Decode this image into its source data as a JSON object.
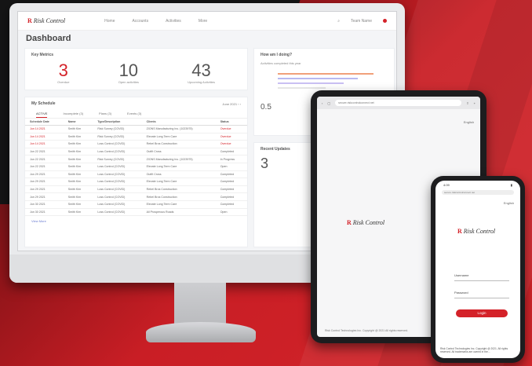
{
  "brand": {
    "name": "Risk Control",
    "mark": "R"
  },
  "nav": {
    "items": [
      "Home",
      "Accounts",
      "Activities",
      "More"
    ],
    "user": "Team Name"
  },
  "dashboard": {
    "title": "Dashboard",
    "metrics_title": "Key Metrics",
    "metrics": [
      {
        "value": "3",
        "label": "Overdue"
      },
      {
        "value": "10",
        "label": "Open activities"
      },
      {
        "value": "43",
        "label": "Upcoming Activities"
      }
    ],
    "schedule": {
      "title": "My Schedule",
      "period": "June 2021",
      "tabs": [
        "ACTIVE",
        "Incomplete (3)",
        "Plans (3)",
        "Events (3)"
      ],
      "columns": [
        "Schedule Date",
        "Name",
        "Type/Description",
        "Clients",
        "Status"
      ],
      "rows": [
        [
          "Jun 14 2021",
          "Smith Kim",
          "Risk Survey (COVID)",
          "ZIONS Manufacturing Inc. (1023975)",
          "Overdue"
        ],
        [
          "Jun 14 2021",
          "Smith Kim",
          "Risk Survey (COVID)",
          "Elevate Long Term Care",
          "Overdue"
        ],
        [
          "Jun 14 2021",
          "Smith Kim",
          "Loss Control (COVID)",
          "Rebel Bros Construction",
          "Overdue"
        ],
        [
          "Jun 22 2021",
          "Smith Kim",
          "Loss Control (COVID)",
          "Outfit Cross",
          "Completed"
        ],
        [
          "Jun 22 2021",
          "Smith Kim",
          "Risk Survey (COVID)",
          "ZIONS Manufacturing Inc. (1023975)",
          "In Progress"
        ],
        [
          "Jun 22 2021",
          "Smith Kim",
          "Loss Control (COVID)",
          "Elevate Long Term Care",
          "Open"
        ],
        [
          "Jun 29 2021",
          "Smith Kim",
          "Loss Control (COVID)",
          "Outfit Cross",
          "Completed"
        ],
        [
          "Jun 29 2021",
          "Smith Kim",
          "Loss Control (COVID)",
          "Elevate Long Term Care",
          "Completed"
        ],
        [
          "Jun 29 2021",
          "Smith Kim",
          "Loss Control (COVID)",
          "Rebel Bros Construction",
          "Completed"
        ],
        [
          "Jun 29 2021",
          "Smith Kim",
          "Loss Control (COVID)",
          "Rebel Bros Construction",
          "Completed"
        ],
        [
          "Jun 30 2021",
          "Smith Kim",
          "Loss Control (COVID)",
          "Elevate Long Term Care",
          "Completed"
        ],
        [
          "Jun 30 2021",
          "Smith Kim",
          "Loss Control (COVID)",
          "All Prosperous Roads",
          "Open"
        ]
      ],
      "view_more": "View More"
    },
    "how_title": "How am I doing?",
    "how_subtitle": "Activities completed this year",
    "recent_title": "Recent Updates",
    "recent_count": "3",
    "stat": "0.5"
  },
  "tablet": {
    "url": "secure.riskcontrolconnect.net",
    "lang": "English",
    "footer": "Risk Control Technologies Inc. Copyright @ 2021 All rights reserved."
  },
  "phone": {
    "time": "4:09",
    "url": "secure.riskcontrolconnect.net",
    "lang": "English",
    "username_label": "Username",
    "password_label": "Password",
    "login_label": "Login",
    "footer": "Risk Control Technologies Inc. Copyright @ 2021. All rights reserved. All trademarks are owned in the..."
  },
  "colors": {
    "accent": "#d42229"
  }
}
